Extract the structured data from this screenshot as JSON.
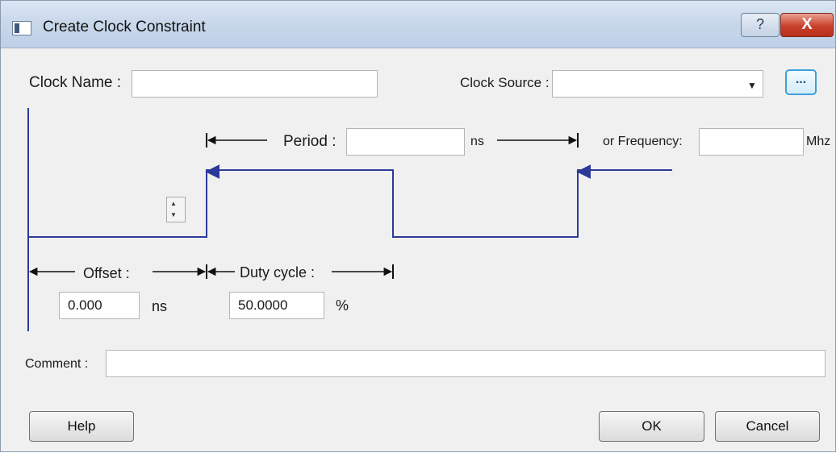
{
  "window": {
    "title": "Create Clock Constraint",
    "help_glyph": "?",
    "close_glyph": "X"
  },
  "clock_name": {
    "label": "Clock Name :",
    "value": ""
  },
  "clock_source": {
    "label": "Clock Source :",
    "value": "",
    "arrow": "▼",
    "browse_label": "..."
  },
  "period": {
    "label": "Period :",
    "value": "",
    "unit": "ns"
  },
  "frequency": {
    "label": "or Frequency:",
    "value": "",
    "unit": "Mhz"
  },
  "offset": {
    "label": "Offset :",
    "value": "0.000",
    "unit": "ns"
  },
  "duty_cycle": {
    "label": "Duty cycle :",
    "value": "50.0000",
    "unit": "%"
  },
  "comment": {
    "label": "Comment :",
    "value": ""
  },
  "buttons": {
    "help": "Help",
    "ok": "OK",
    "cancel": "Cancel"
  },
  "colors": {
    "waveform": "#2b3a99",
    "title_bar": "#c9d8ea",
    "close": "#c9412b"
  },
  "icons": [
    "app-window-icon",
    "help-icon",
    "close-icon",
    "dropdown-arrow-icon",
    "browse-icon",
    "spinner-up-icon",
    "spinner-down-icon"
  ]
}
